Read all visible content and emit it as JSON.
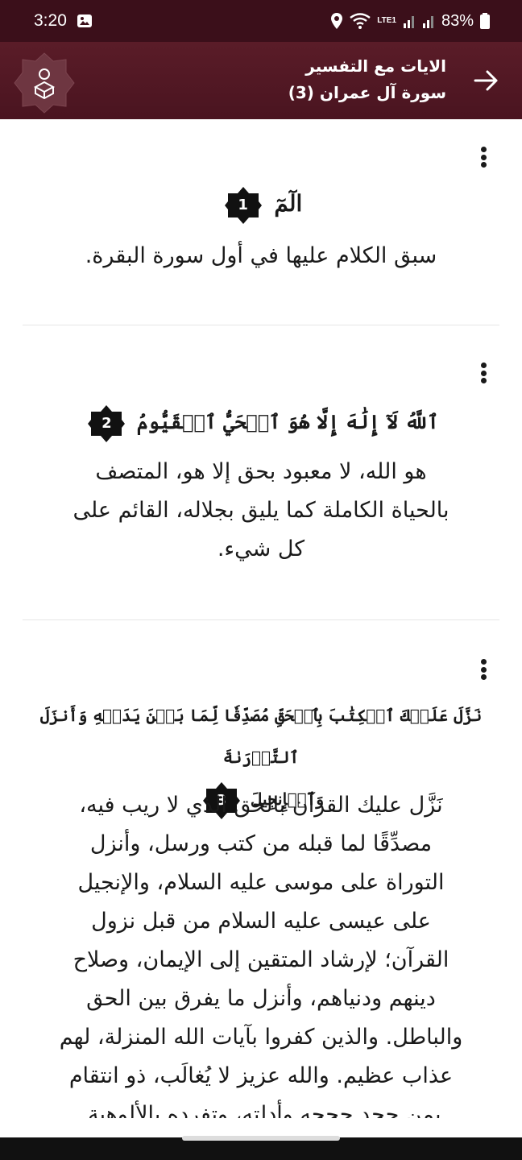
{
  "status": {
    "time": "3:20",
    "battery": "83%",
    "network_label": "LTE1"
  },
  "header": {
    "title": "الايات مع التفسير",
    "subtitle": "سورة آل عمران (3)"
  },
  "ayat": [
    {
      "number": "1",
      "text": "الٓمٓ",
      "tafsir": "سبق الكلام عليها في أول سورة البقرة."
    },
    {
      "number": "2",
      "text": "ٱللَّهُ لَآ إِلَٰهَ إِلَّا هُوَ ٱلۡحَيُّ ٱلۡقَيُّومُ",
      "tafsir_lines": [
        "هو الله، لا معبود بحق إلا هو، المتصف",
        "بالحياة الكاملة كما يليق بجلاله، القائم على",
        "كل شيء."
      ]
    },
    {
      "number": "3",
      "text_lines": [
        "نَزَّلَ عَلَيۡكَ ٱلۡكِتَٰبَ بِٱلۡحَقِّ مُصَدِّقٗا لِّمَا بَيۡنَ يَدَيۡهِ وَأَنزَلَ ٱلتَّوۡرَىٰةَ",
        "وَٱلۡإِنجِيلَ"
      ],
      "tafsir_lines": [
        "نَزَّل عليك القرآن بالحق الذي لا ريب فيه،",
        "مصدِّقًا لما قبله من كتب ورسل، وأنزل",
        "التوراة على موسى عليه السلام، والإنجيل",
        "على عيسى عليه السلام من قبل نزول",
        "القرآن؛ لإرشاد المتقين إلى الإيمان، وصلاح",
        "دينهم ودنياهم، وأنزل ما يفرق بين الحق",
        "والباطل. والذين كفروا بآيات الله المنزلة، لهم",
        "عذاب عظيم. والله عزيز لا يُغالَب، ذو انتقام",
        "بمن جحد حججه وأدلته، وتفرده بالألوهية."
      ]
    }
  ],
  "colors": {
    "header_bg": "#4a1420",
    "status_bg": "#3b0f1a",
    "badge": "#111111"
  },
  "icons": {
    "back": "arrow-right-icon",
    "logo": "reader-quran-logo",
    "menu": "kebab-menu-icon"
  }
}
